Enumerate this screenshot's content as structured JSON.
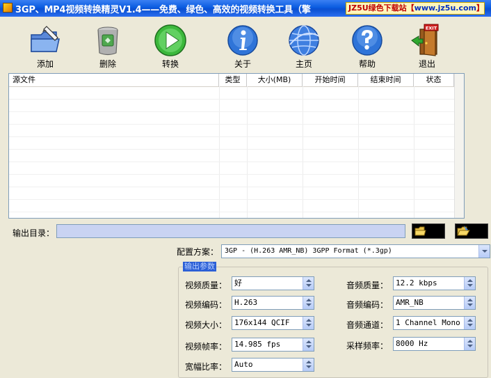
{
  "window": {
    "title": "3GP、MP4视频转换精灵V1.4——免费、绿色、高效的视频转换工具（擎",
    "watermark_prefix": "JZ5U绿色下载站【",
    "watermark_url": "www.jz5u.com",
    "watermark_suffix": "】"
  },
  "toolbar": [
    {
      "label": "添加",
      "icon": "add-folder-icon"
    },
    {
      "label": "删除",
      "icon": "trash-bin-icon"
    },
    {
      "label": "转换",
      "icon": "play-icon"
    },
    {
      "label": "关于",
      "icon": "info-icon"
    },
    {
      "label": "主页",
      "icon": "globe-icon"
    },
    {
      "label": "帮助",
      "icon": "help-icon"
    },
    {
      "label": "退出",
      "icon": "exit-door-icon"
    }
  ],
  "exit_sign": "EXIT",
  "table": {
    "columns": [
      "源文件",
      "类型",
      "大小(MB)",
      "开始时间",
      "结束时间",
      "状态"
    ],
    "rows": []
  },
  "output": {
    "label": "输出目录：",
    "value": ""
  },
  "config": {
    "label": "配置方案：",
    "value": "3GP - (H.263 AMR_NB) 3GPP Format (*.3gp)"
  },
  "params": {
    "title": "输出参数",
    "left": [
      {
        "label": "视频质量：",
        "value": "好"
      },
      {
        "label": "视频编码：",
        "value": "H.263"
      },
      {
        "label": "视频大小：",
        "value": "176x144 QCIF"
      },
      {
        "label": "视频帧率：",
        "value": "14.985 fps"
      },
      {
        "label": "宽幅比率：",
        "value": "Auto"
      }
    ],
    "right": [
      {
        "label": "音频质量：",
        "value": "12.2  kbps"
      },
      {
        "label": "音频编码：",
        "value": "AMR_NB"
      },
      {
        "label": "音频通道：",
        "value": "1 Channel Mono"
      },
      {
        "label": "采样频率：",
        "value": "8000  Hz"
      }
    ]
  },
  "colors": {
    "titlebar": "#0a5be0",
    "window_bg": "#ECE9D8",
    "output_field": "#c9d3f2",
    "group_title_bg": "#2b5fd6"
  }
}
